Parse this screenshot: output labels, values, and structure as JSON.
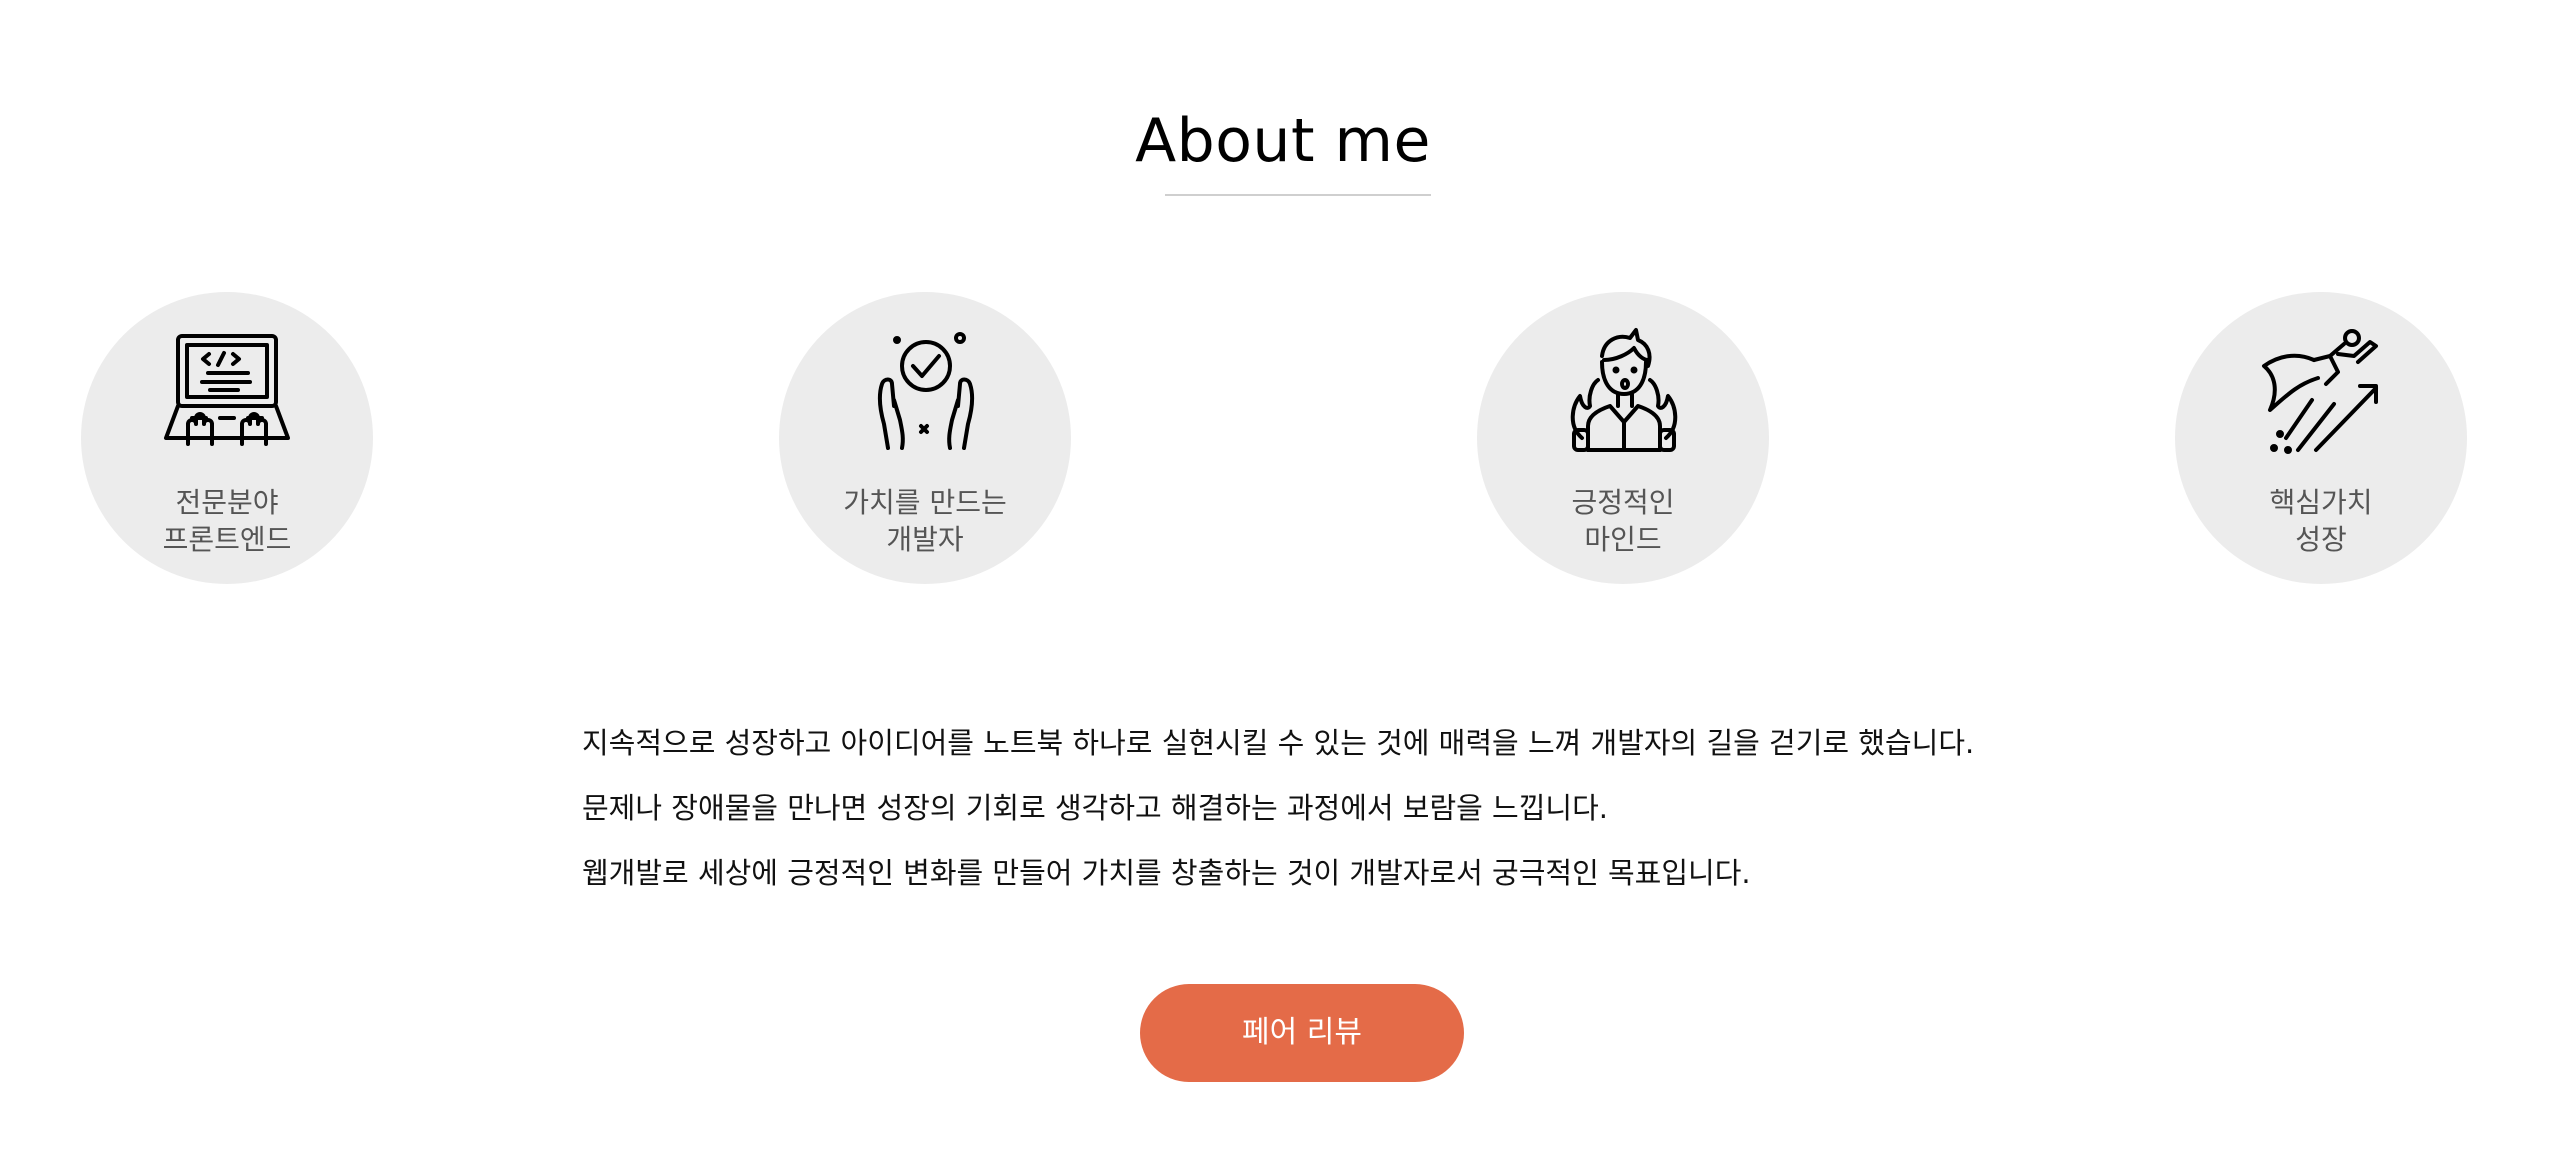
{
  "section": {
    "title": "About me"
  },
  "cards": [
    {
      "icon": "laptop-code-icon",
      "line1": "전문분야",
      "line2": "프론트엔드"
    },
    {
      "icon": "hands-check-icon",
      "line1": "가치를 만드는",
      "line2": "개발자"
    },
    {
      "icon": "passionate-person-icon",
      "line1": "긍정적인",
      "line2": "마인드"
    },
    {
      "icon": "flying-hero-growth-icon",
      "line1": "핵심가치",
      "line2": "성장"
    }
  ],
  "intro": {
    "lines": [
      "지속적으로 성장하고 아이디어를 노트북 하나로 실현시킬 수 있는 것에 매력을 느껴 개발자의 길을 걷기로 했습니다.",
      "문제나 장애물을 만나면 성장의 기회로 생각하고 해결하는 과정에서 보람을 느낍니다.",
      "웹개발로 세상에 긍정적인 변화를 만들어 가치를 창출하는 것이 개발자로서 궁극적인 목표입니다."
    ]
  },
  "cta": {
    "label": "페어 리뷰"
  },
  "colors": {
    "accent": "#e46b48",
    "card_bg": "#ececec",
    "label_text": "#555555",
    "rule": "#cfcfcf"
  }
}
